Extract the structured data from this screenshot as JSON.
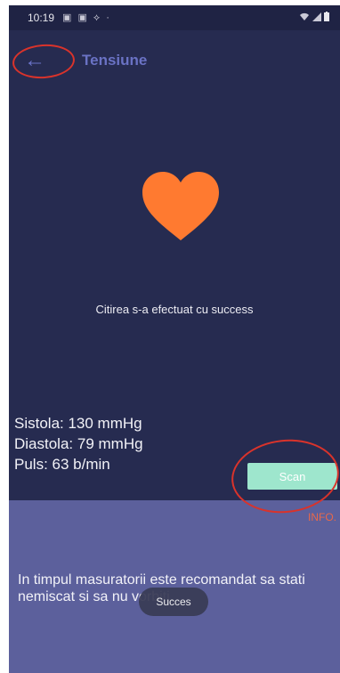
{
  "status_bar": {
    "time": "10:19",
    "notification_icons": "▣ ▣ ⟡ ·",
    "system_icons": "wifi-icon signal-icon battery-icon"
  },
  "app_bar": {
    "back_icon": "←",
    "title": "Tensiune"
  },
  "main": {
    "heart_icon": "heart-icon",
    "heart_color": "#ff7a30",
    "result_message": "Citirea s-a efectuat cu success",
    "readings": {
      "systolic": "Sistola: 130 mmHg",
      "diastolic": "Diastola: 79 mmHg",
      "pulse": "Puls: 63 b/min"
    },
    "scan_button": "Scan"
  },
  "info": {
    "link": "INFO.",
    "text": "In timpul masuratorii este recomandat sa stati nemiscat si sa nu vorbiti."
  },
  "toast": {
    "message": "Succes"
  },
  "colors": {
    "background": "#262b50",
    "info_panel": "#5c609c",
    "accent": "#9ee6cd",
    "annotation": "#d9332b"
  }
}
